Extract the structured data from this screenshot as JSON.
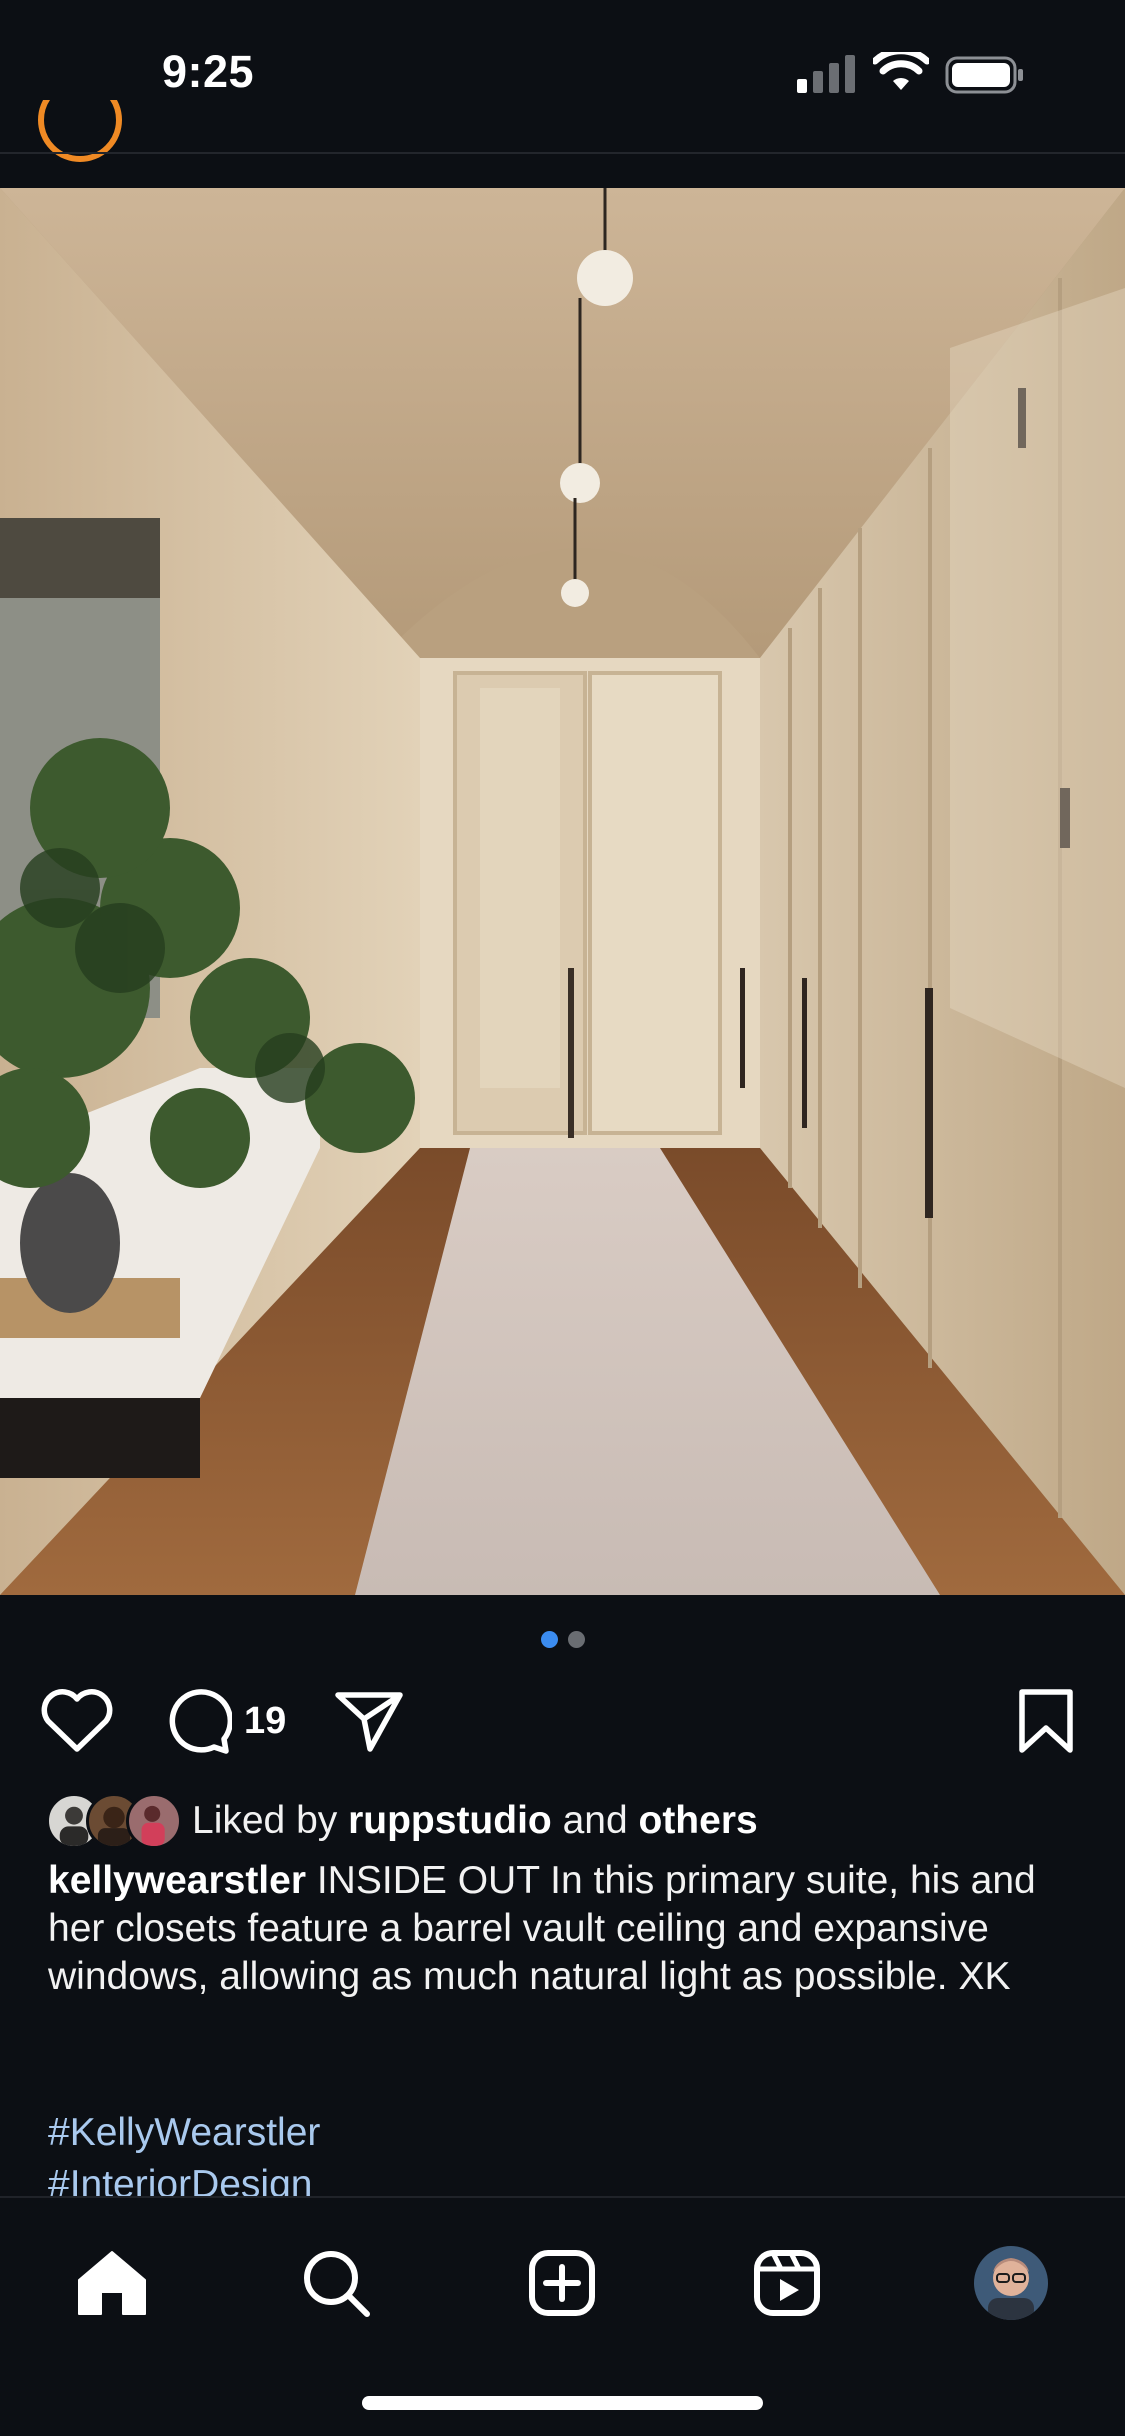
{
  "status_bar": {
    "time": "9:25",
    "icons": [
      "cellular-signal-icon",
      "wifi-icon",
      "battery-icon"
    ]
  },
  "post": {
    "image_alt": "Interior hallway with barrel vault ceiling, closets, runner rug and bench with plant",
    "carousel": {
      "count": 2,
      "active_index": 0
    },
    "actions": {
      "icons": [
        "heart-icon",
        "comment-icon",
        "share-icon",
        "bookmark-icon"
      ],
      "comment_count": "19"
    },
    "likes": {
      "prefix": "Liked by ",
      "user": "ruppstudio",
      "middle": " and ",
      "suffix": "others"
    },
    "caption": {
      "username": "kellywearstler",
      "text": " INSIDE OUT In this primary suite, his and her closets feature a barrel vault ceiling and expansive windows, allowing as much natural light as possible. XK"
    },
    "hashtags": [
      "#KellyWearstler",
      "#InteriorDesign"
    ]
  },
  "bottom_nav": {
    "items": [
      "home-icon",
      "search-icon",
      "create-icon",
      "reels-icon",
      "profile-avatar"
    ]
  },
  "colors": {
    "background": "#0c0f14",
    "accent_dot": "#3b8cf0",
    "hashtag": "#a9c9ee",
    "story_ring": "#f08a24"
  }
}
